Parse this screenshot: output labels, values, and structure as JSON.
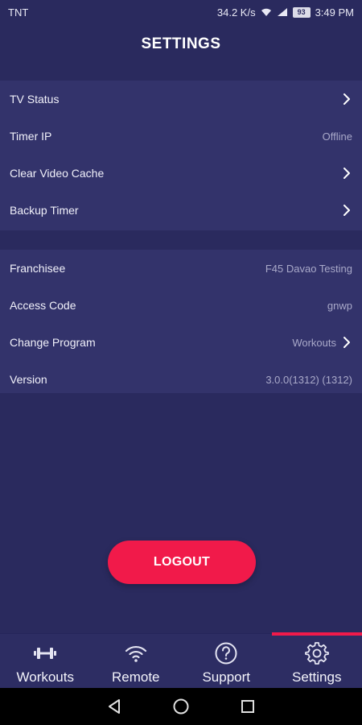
{
  "status_bar": {
    "carrier": "TNT",
    "speed": "34.2 K/s",
    "battery": "93",
    "time": "3:49 PM"
  },
  "header": {
    "title": "SETTINGS"
  },
  "group1": [
    {
      "label": "TV Status",
      "value": "",
      "chevron": true
    },
    {
      "label": "Timer IP",
      "value": "Offline",
      "chevron": false
    },
    {
      "label": "Clear Video Cache",
      "value": "",
      "chevron": true
    },
    {
      "label": "Backup Timer",
      "value": "",
      "chevron": true
    }
  ],
  "group2": [
    {
      "label": "Franchisee",
      "value": "F45 Davao Testing",
      "chevron": false
    },
    {
      "label": "Access Code",
      "value": "gnwp",
      "chevron": false
    },
    {
      "label": "Change Program",
      "value": "Workouts",
      "chevron": true
    },
    {
      "label": "Version",
      "value": "3.0.0(1312) (1312)",
      "chevron": false
    }
  ],
  "logout_label": "LOGOUT",
  "tabs": [
    {
      "label": "Workouts",
      "icon": "dumbbell-icon"
    },
    {
      "label": "Remote",
      "icon": "wifi-icon"
    },
    {
      "label": "Support",
      "icon": "help-icon"
    },
    {
      "label": "Settings",
      "icon": "gear-icon",
      "active": true
    }
  ],
  "colors": {
    "background": "#2a2a5e",
    "panel": "#33336b",
    "accent": "#f11a4a"
  }
}
